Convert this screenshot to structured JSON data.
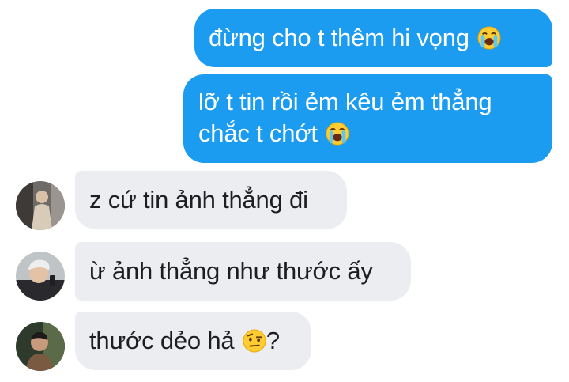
{
  "messages": [
    {
      "sender": "me",
      "text": "đừng cho t thêm hi vọng",
      "emoji": "loudly-crying-face-icon"
    },
    {
      "sender": "me",
      "line1": "lỡ t tin rồi ẻm kêu ẻm thẳng",
      "line2": "chắc t chớt",
      "emoji": "loudly-crying-face-icon"
    },
    {
      "sender": "friend-1",
      "text": "z cứ tin ảnh thẳng đi"
    },
    {
      "sender": "friend-2",
      "text": "ừ ảnh thẳng như thước ấy"
    },
    {
      "sender": "friend-3",
      "text": "thước dẻo hả",
      "emoji": "face-with-raised-eyebrow-icon",
      "suffix": "?"
    }
  ],
  "colors": {
    "outgoing_bubble": "#1b9cf0",
    "incoming_bubble": "#ebedf0",
    "outgoing_text": "#ffffff",
    "incoming_text": "#1c1e21"
  }
}
